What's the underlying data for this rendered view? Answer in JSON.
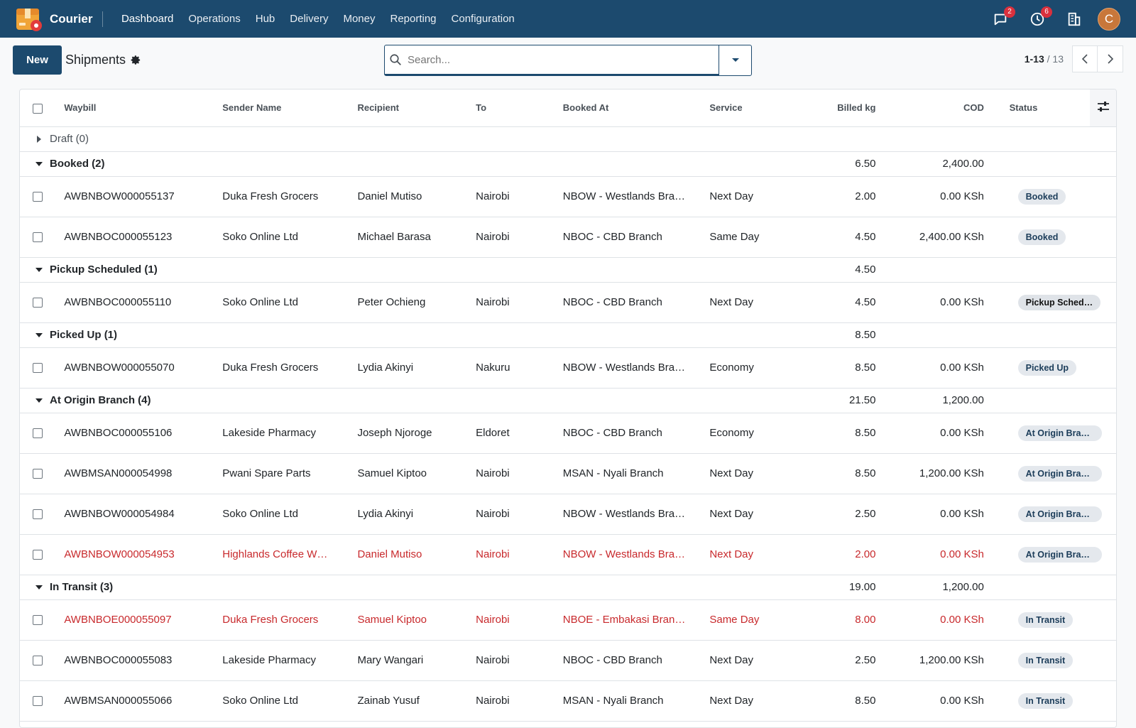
{
  "app": {
    "name": "Courier"
  },
  "menu": [
    "Dashboard",
    "Operations",
    "Hub",
    "Delivery",
    "Money",
    "Reporting",
    "Configuration"
  ],
  "nav": {
    "messages_count": "2",
    "activities_count": "6",
    "avatar_letter": "C"
  },
  "toolbar": {
    "new_label": "New",
    "title": "Shipments"
  },
  "search": {
    "placeholder": "Search..."
  },
  "pager": {
    "range": "1-13",
    "separator": " / ",
    "total": "13"
  },
  "table": {
    "columns": [
      "Waybill",
      "Sender Name",
      "Recipient",
      "To",
      "Booked At",
      "Service",
      "Billed kg",
      "COD",
      "Status"
    ],
    "groups": [
      {
        "label": "Draft (0)",
        "folded": true,
        "kg": "",
        "cod": "",
        "rows": []
      },
      {
        "label": "Booked (2)",
        "folded": false,
        "kg": "6.50",
        "cod": "2,400.00",
        "rows": [
          {
            "waybill": "AWBNBOW000055137",
            "sender": "Duka Fresh Grocers",
            "recipient": "Daniel Mutiso",
            "to": "Nairobi",
            "booked_at": "NBOW - Westlands Bra…",
            "service": "Next Day",
            "kg": "2.00",
            "cod": "0.00 KSh",
            "status": "Booked",
            "overdue": false
          },
          {
            "waybill": "AWBNBOC000055123",
            "sender": "Soko Online Ltd",
            "recipient": "Michael Barasa",
            "to": "Nairobi",
            "booked_at": "NBOC - CBD Branch",
            "service": "Same Day",
            "kg": "4.50",
            "cod": "2,400.00 KSh",
            "status": "Booked",
            "overdue": false
          }
        ]
      },
      {
        "label": "Pickup Scheduled (1)",
        "folded": false,
        "kg": "4.50",
        "cod": "",
        "rows": [
          {
            "waybill": "AWBNBOC000055110",
            "sender": "Soko Online Ltd",
            "recipient": "Peter Ochieng",
            "to": "Nairobi",
            "booked_at": "NBOC - CBD Branch",
            "service": "Next Day",
            "kg": "4.50",
            "cod": "0.00 KSh",
            "status": "Pickup Sched…",
            "overdue": false
          }
        ]
      },
      {
        "label": "Picked Up (1)",
        "folded": false,
        "kg": "8.50",
        "cod": "",
        "rows": [
          {
            "waybill": "AWBNBOW000055070",
            "sender": "Duka Fresh Grocers",
            "recipient": "Lydia Akinyi",
            "to": "Nakuru",
            "booked_at": "NBOW - Westlands Bra…",
            "service": "Economy",
            "kg": "8.50",
            "cod": "0.00 KSh",
            "status": "Picked Up",
            "overdue": false
          }
        ]
      },
      {
        "label": "At Origin Branch (4)",
        "folded": false,
        "kg": "21.50",
        "cod": "1,200.00",
        "rows": [
          {
            "waybill": "AWBNBOC000055106",
            "sender": "Lakeside Pharmacy",
            "recipient": "Joseph Njoroge",
            "to": "Eldoret",
            "booked_at": "NBOC - CBD Branch",
            "service": "Economy",
            "kg": "8.50",
            "cod": "0.00 KSh",
            "status": "At Origin Branch",
            "overdue": false
          },
          {
            "waybill": "AWBMSAN000054998",
            "sender": "Pwani Spare Parts",
            "recipient": "Samuel Kiptoo",
            "to": "Nairobi",
            "booked_at": "MSAN - Nyali Branch",
            "service": "Next Day",
            "kg": "8.50",
            "cod": "1,200.00 KSh",
            "status": "At Origin Branch",
            "overdue": false
          },
          {
            "waybill": "AWBNBOW000054984",
            "sender": "Soko Online Ltd",
            "recipient": "Lydia Akinyi",
            "to": "Nairobi",
            "booked_at": "NBOW - Westlands Bra…",
            "service": "Next Day",
            "kg": "2.50",
            "cod": "0.00 KSh",
            "status": "At Origin Branch",
            "overdue": false
          },
          {
            "waybill": "AWBNBOW000054953",
            "sender": "Highlands Coffee W…",
            "recipient": "Daniel Mutiso",
            "to": "Nairobi",
            "booked_at": "NBOW - Westlands Bra…",
            "service": "Next Day",
            "kg": "2.00",
            "cod": "0.00 KSh",
            "status": "At Origin Branch",
            "overdue": true
          }
        ]
      },
      {
        "label": "In Transit (3)",
        "folded": false,
        "kg": "19.00",
        "cod": "1,200.00",
        "rows": [
          {
            "waybill": "AWBNBOE000055097",
            "sender": "Duka Fresh Grocers",
            "recipient": "Samuel Kiptoo",
            "to": "Nairobi",
            "booked_at": "NBOE - Embakasi Bran…",
            "service": "Same Day",
            "kg": "8.00",
            "cod": "0.00 KSh",
            "status": "In Transit",
            "overdue": true
          },
          {
            "waybill": "AWBNBOC000055083",
            "sender": "Lakeside Pharmacy",
            "recipient": "Mary Wangari",
            "to": "Nairobi",
            "booked_at": "NBOC - CBD Branch",
            "service": "Next Day",
            "kg": "2.50",
            "cod": "1,200.00 KSh",
            "status": "In Transit",
            "overdue": false
          },
          {
            "waybill": "AWBMSAN000055066",
            "sender": "Soko Online Ltd",
            "recipient": "Zainab Yusuf",
            "to": "Nairobi",
            "booked_at": "MSAN - Nyali Branch",
            "service": "Next Day",
            "kg": "8.50",
            "cod": "0.00 KSh",
            "status": "In Transit",
            "overdue": false
          }
        ]
      }
    ]
  },
  "colors": {
    "navbar": "#1c4a6e",
    "overdue_text": "#c8292c",
    "badge": "#d9303d",
    "avatar": "#c8773a"
  }
}
